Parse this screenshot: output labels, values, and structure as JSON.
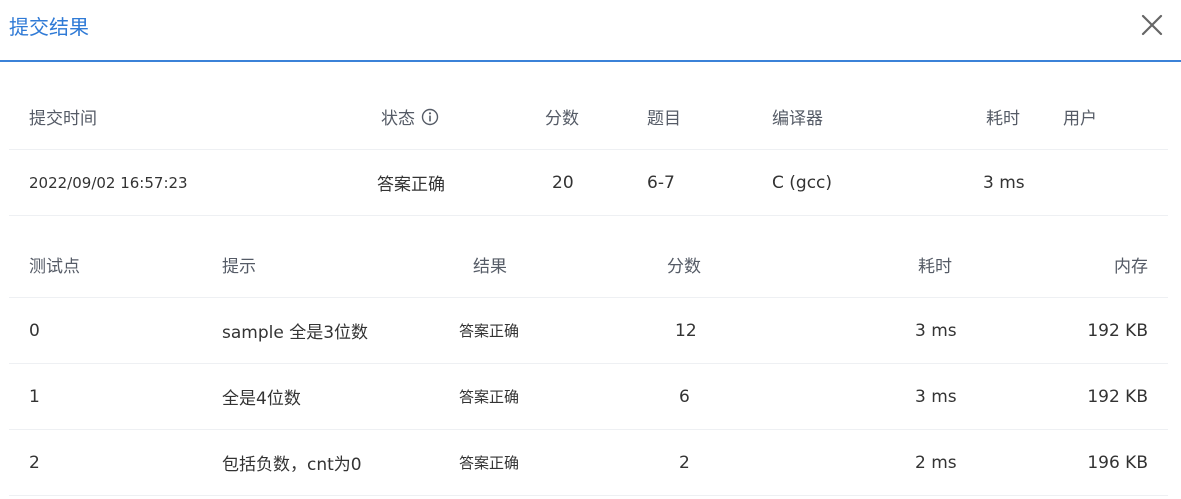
{
  "dialog": {
    "title": "提交结果",
    "close_label": "close"
  },
  "submission": {
    "headers": {
      "time": "提交时间",
      "status": "状态",
      "score": "分数",
      "problem": "题目",
      "compiler": "编译器",
      "duration": "耗时",
      "user": "用户"
    },
    "row": {
      "time": "2022/09/02 16:57:23",
      "status": "答案正确",
      "score": "20",
      "problem": "6-7",
      "compiler": "C (gcc)",
      "duration": "3 ms",
      "user": ""
    }
  },
  "cases": {
    "headers": {
      "id": "测试点",
      "hint": "提示",
      "result": "结果",
      "score": "分数",
      "duration": "耗时",
      "memory": "内存"
    },
    "rows": [
      {
        "id": "0",
        "hint": "sample 全是3位数",
        "result": "答案正确",
        "score": "12",
        "duration": "3 ms",
        "memory": "192 KB"
      },
      {
        "id": "1",
        "hint": "全是4位数",
        "result": "答案正确",
        "score": "6",
        "duration": "3 ms",
        "memory": "192 KB"
      },
      {
        "id": "2",
        "hint": "包括负数，cnt为0",
        "result": "答案正确",
        "score": "2",
        "duration": "2 ms",
        "memory": "196 KB"
      }
    ]
  },
  "colors": {
    "accent": "#2f7ad6",
    "success_text": "#e5403b",
    "divider": "#eef0f3"
  }
}
